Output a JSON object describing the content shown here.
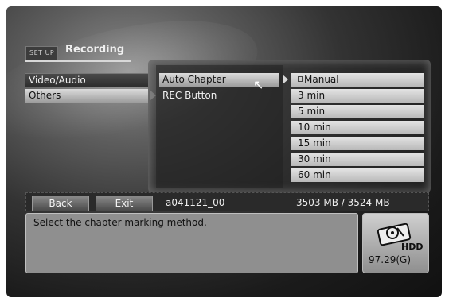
{
  "header": {
    "badge": "SET UP",
    "title": "Recording"
  },
  "main_menu": [
    {
      "label": "Video/Audio"
    },
    {
      "label": "Others"
    }
  ],
  "sub_menu": [
    {
      "label": "Auto Chapter"
    },
    {
      "label": "REC Button"
    }
  ],
  "options": [
    {
      "label": "Manual"
    },
    {
      "label": "3 min"
    },
    {
      "label": "5 min"
    },
    {
      "label": "10 min"
    },
    {
      "label": "15 min"
    },
    {
      "label": "30 min"
    },
    {
      "label": "60 min"
    }
  ],
  "status_bar": {
    "back_label": "Back",
    "exit_label": "Exit",
    "title_name": "a041121_00",
    "capacity": "3503 MB / 3524 MB"
  },
  "message": "Select the chapter marking method.",
  "hdd": {
    "label": "HDD",
    "value": "97.29(G)",
    "icon": "hdd-icon"
  },
  "colors": {
    "selected_light": "#dcdcdc",
    "background": "#1b1b1b",
    "message_box": "#8f8f8f"
  }
}
